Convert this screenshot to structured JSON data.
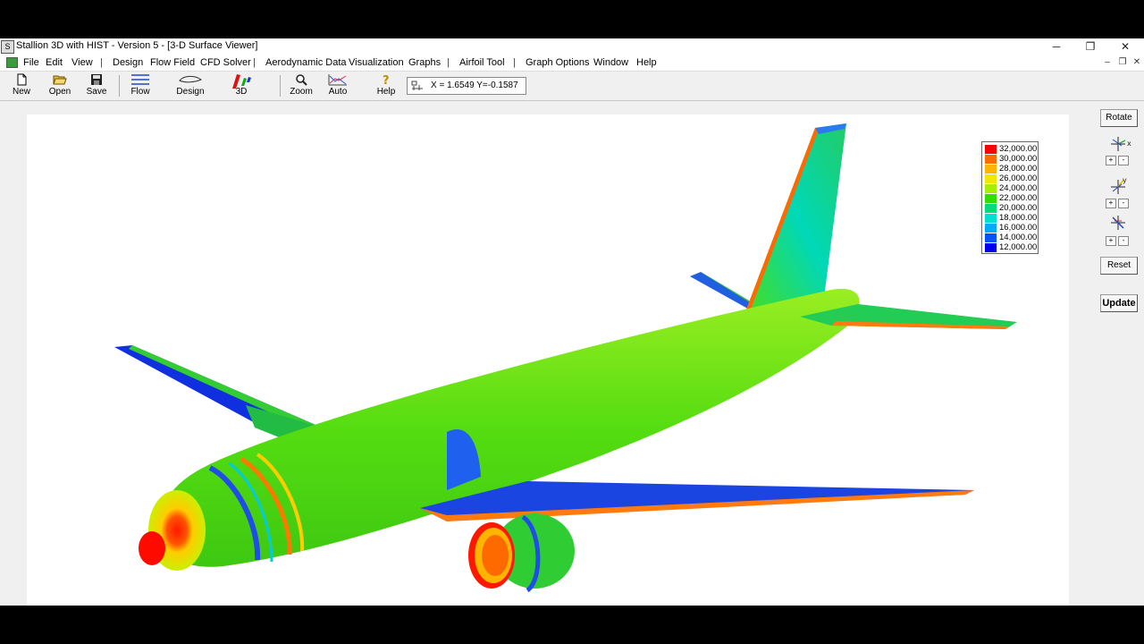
{
  "window": {
    "title": "Stallion 3D with HIST - Version 5 - [3-D Surface Viewer]",
    "app_icon_glyph": "S",
    "controls": {
      "minimize": "─",
      "restore": "❐",
      "close": "✕"
    },
    "mdi_controls": {
      "minimize": "–",
      "restore": "❐",
      "close": "✕"
    }
  },
  "menu": {
    "file": "File",
    "edit": "Edit",
    "view": "View",
    "design": "Design",
    "flow_field": "Flow Field",
    "cfd_solver": "CFD Solver",
    "aerodynamic_data": "Aerodynamic Data",
    "visualization": "Visualization",
    "graphs": "Graphs",
    "airfoil_tool": "Airfoil Tool",
    "graph_options": "Graph Options",
    "window": "Window",
    "help": "Help",
    "separator": "|"
  },
  "toolbar": {
    "new": "New",
    "open": "Open",
    "save": "Save",
    "flow": "Flow",
    "design": "Design",
    "three_d": "3D",
    "zoom": "Zoom",
    "auto": "Auto",
    "help": "Help"
  },
  "coords": {
    "text": "X = 1.6549  Y=-0.1587"
  },
  "side_panel": {
    "rotate": "Rotate",
    "x_label": "x",
    "y_label": "y",
    "plus": "+",
    "minus": "-",
    "reset": "Reset",
    "update": "Update"
  },
  "legend": {
    "labels": [
      "32,000.00",
      "30,000.00",
      "28,000.00",
      "26,000.00",
      "24,000.00",
      "22,000.00",
      "20,000.00",
      "18,000.00",
      "16,000.00",
      "14,000.00",
      "12,000.00"
    ],
    "colors": [
      "#ff0000",
      "#ff6a00",
      "#ffb400",
      "#f0e800",
      "#a8ee00",
      "#33dd00",
      "#00dd77",
      "#00e0d0",
      "#00aaff",
      "#0055ff",
      "#0000ee"
    ]
  },
  "icons": [
    "new-icon",
    "open-icon",
    "save-icon",
    "flow-icon",
    "design-icon",
    "3d-icon",
    "zoom-icon",
    "auto-icon",
    "help-icon",
    "coord-icon",
    "rotate-x-icon",
    "rotate-y-icon",
    "rotate-z-icon"
  ]
}
